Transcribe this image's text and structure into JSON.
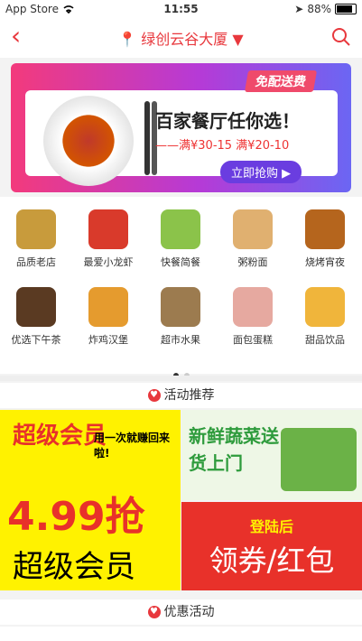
{
  "status": {
    "carrier": "App Store",
    "time": "11:55",
    "battery": "88%"
  },
  "nav": {
    "location": "绿创云谷大厦"
  },
  "banner": {
    "tag": "免配送费",
    "title": "百家餐厅任你选！",
    "subtitle": "——满¥30-15  满¥20-10",
    "button": "立即抢购"
  },
  "categories": [
    {
      "label": "品质老店",
      "icon": "star-badge-icon",
      "color": "#c89b3c"
    },
    {
      "label": "最爱小龙虾",
      "icon": "crayfish-icon",
      "color": "#d93a2b"
    },
    {
      "label": "快餐简餐",
      "icon": "salad-icon",
      "color": "#8bc34a"
    },
    {
      "label": "粥粉面",
      "icon": "noodle-bowl-icon",
      "color": "#e0b070"
    },
    {
      "label": "烧烤宵夜",
      "icon": "grill-icon",
      "color": "#b5651d"
    },
    {
      "label": "优选下午茶",
      "icon": "coffee-icon",
      "color": "#5a3a22"
    },
    {
      "label": "炸鸡汉堡",
      "icon": "burger-icon",
      "color": "#e59b2e"
    },
    {
      "label": "超市水果",
      "icon": "fruit-basket-icon",
      "color": "#9c7b4f"
    },
    {
      "label": "面包蛋糕",
      "icon": "cake-icon",
      "color": "#e6a9a0"
    },
    {
      "label": "甜品饮品",
      "icon": "drink-icon",
      "color": "#f0b53b"
    }
  ],
  "sections": {
    "activity": "活动推荐",
    "discount": "优惠活动"
  },
  "promos": {
    "left_top": "超级会员",
    "left_note": "用一次就赚回来啦!",
    "left_price": "4.99抢",
    "left_bottom": "超级会员",
    "right_top": "新鲜蔬菜送货上门",
    "right_tag": "登陆后",
    "right_bottom": "领券/红包"
  }
}
